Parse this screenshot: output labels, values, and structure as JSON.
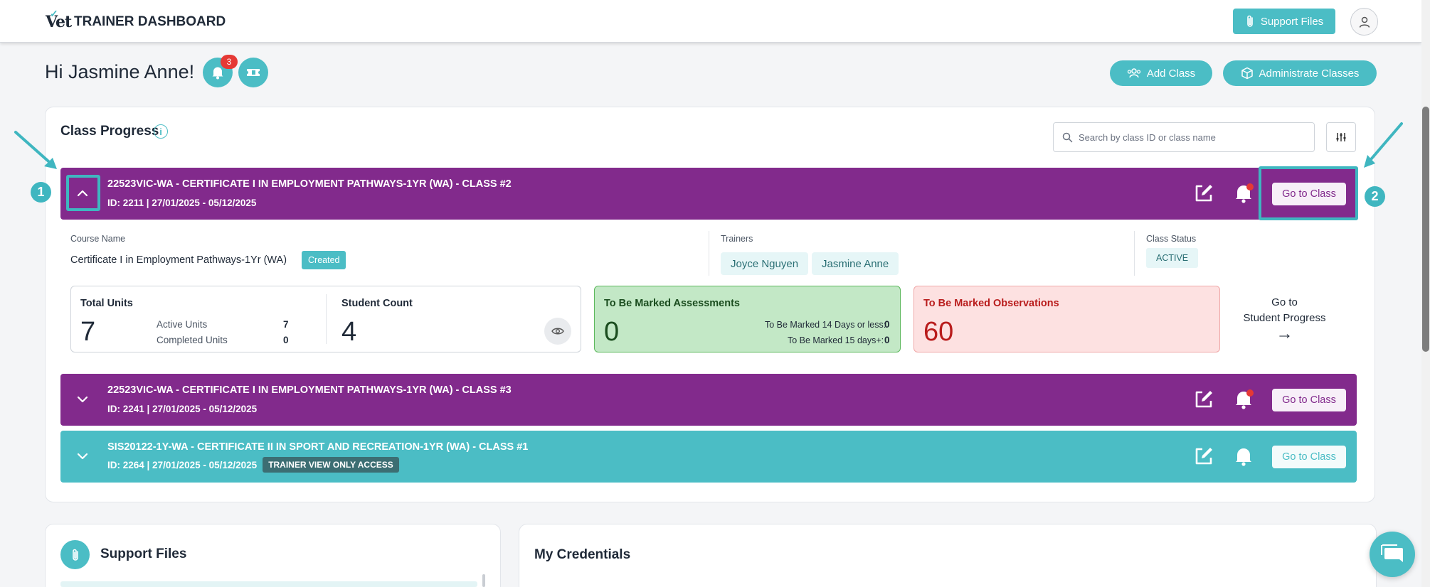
{
  "header": {
    "logo_text": "Vet",
    "app_title": "TRAINER DASHBOARD",
    "support_files_label": "Support Files"
  },
  "greeting": {
    "text": "Hi Jasmine Anne!",
    "notification_count": "3"
  },
  "actions": {
    "add_class_label": "Add Class",
    "administrate_label": "Administrate Classes"
  },
  "class_progress": {
    "title": "Class Progress",
    "info_glyph": "i",
    "search_placeholder": "Search by class ID or class name",
    "classes": [
      {
        "title": "22523VIC-WA - CERTIFICATE I IN EMPLOYMENT PATHWAYS-1YR (WA) - CLASS #2",
        "sub": "ID: 2211 | 27/01/2025 - 05/12/2025",
        "go_label": "Go to Class",
        "color": "#822a8c",
        "expanded": true
      },
      {
        "title": "22523VIC-WA - CERTIFICATE I IN EMPLOYMENT PATHWAYS-1YR (WA) - CLASS #3",
        "sub": "ID: 2241 | 27/01/2025 - 05/12/2025",
        "go_label": "Go to Class",
        "color": "#822a8c",
        "expanded": false
      },
      {
        "title": "SIS20122-1Y-WA - CERTIFICATE II IN SPORT AND RECREATION-1YR (WA) - CLASS #1",
        "sub": "ID: 2264 | 27/01/2025 - 05/12/2025",
        "badge": "TRAINER VIEW ONLY ACCESS",
        "go_label": "Go to Class",
        "color": "#4bbdc5",
        "expanded": false
      }
    ],
    "details": {
      "course_name_label": "Course Name",
      "course_name": "Certificate I in Employment Pathways-1Yr (WA)",
      "created_chip": "Created",
      "trainers_label": "Trainers",
      "trainers": [
        "Joyce Nguyen",
        "Jasmine Anne"
      ],
      "status_label": "Class Status",
      "status": "ACTIVE",
      "total_units_label": "Total Units",
      "total_units": "7",
      "active_units_label": "Active Units",
      "active_units": "7",
      "completed_units_label": "Completed Units",
      "completed_units": "0",
      "student_count_label": "Student Count",
      "student_count": "4",
      "assess_label": "To Be Marked Assessments",
      "assess_total": "0",
      "assess_14_label": "To Be Marked 14 Days or less:",
      "assess_14": "0",
      "assess_15_label": "To Be Marked 15 days+:",
      "assess_15": "0",
      "obs_label": "To Be Marked Observations",
      "obs_total": "60",
      "goto_line1": "Go to",
      "goto_line2": "Student Progress",
      "goto_arrow": "→"
    }
  },
  "annotations": {
    "badge_1": "1",
    "badge_2": "2"
  },
  "bottom": {
    "support_files_title": "Support Files",
    "credentials_title": "My Credentials"
  },
  "colors": {
    "teal": "#4bbdc5",
    "purple": "#822a8c",
    "alert": "#e53935"
  }
}
